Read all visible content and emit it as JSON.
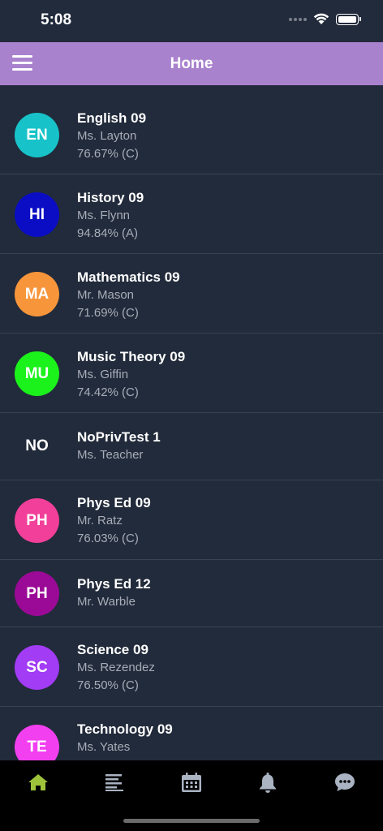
{
  "status": {
    "time": "5:08"
  },
  "header": {
    "title": "Home"
  },
  "courses": [
    {
      "initials": "EN",
      "name": "English 09",
      "teacher": "Ms. Layton",
      "grade": "76.67% (C)",
      "color": "#17c3c9"
    },
    {
      "initials": "HI",
      "name": "History 09",
      "teacher": "Ms. Flynn",
      "grade": "94.84% (A)",
      "color": "#0a0dc4"
    },
    {
      "initials": "MA",
      "name": "Mathematics 09",
      "teacher": "Mr. Mason",
      "grade": "71.69% (C)",
      "color": "#f7953b"
    },
    {
      "initials": "MU",
      "name": "Music Theory 09",
      "teacher": "Ms. Giffin",
      "grade": "74.42% (C)",
      "color": "#1bf21b"
    },
    {
      "initials": "NO",
      "name": "NoPrivTest 1",
      "teacher": "Ms. Teacher",
      "grade": "",
      "color": ""
    },
    {
      "initials": "PH",
      "name": "Phys Ed 09",
      "teacher": "Mr. Ratz",
      "grade": "76.03% (C)",
      "color": "#f23f9a"
    },
    {
      "initials": "PH",
      "name": "Phys Ed 12",
      "teacher": "Mr. Warble",
      "grade": "",
      "color": "#9a0a96"
    },
    {
      "initials": "SC",
      "name": "Science 09",
      "teacher": "Ms. Rezendez",
      "grade": "76.50% (C)",
      "color": "#a23cf5"
    },
    {
      "initials": "TE",
      "name": "Technology 09",
      "teacher": "Ms. Yates",
      "grade": "",
      "color": "#f23ff0"
    }
  ],
  "tabs": [
    {
      "icon": "home-icon",
      "active": true,
      "color": "#9ec33a"
    },
    {
      "icon": "list-icon",
      "active": false,
      "color": "#aab3c2"
    },
    {
      "icon": "calendar-icon",
      "active": false,
      "color": "#aab3c2"
    },
    {
      "icon": "bell-icon",
      "active": false,
      "color": "#aab3c2"
    },
    {
      "icon": "chat-icon",
      "active": false,
      "color": "#aab3c2"
    }
  ]
}
